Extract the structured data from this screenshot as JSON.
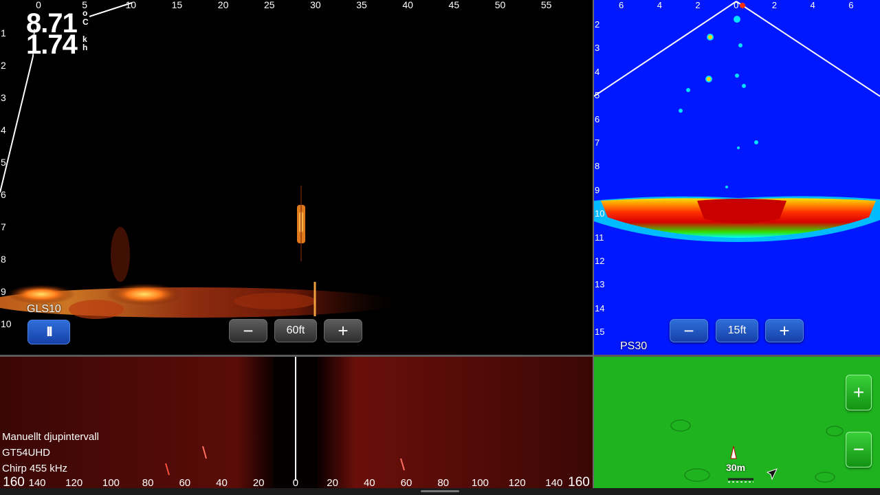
{
  "livescope": {
    "x_ticks": [
      "0",
      "5",
      "10",
      "15",
      "20",
      "25",
      "30",
      "35",
      "40",
      "45",
      "50",
      "55"
    ],
    "y_ticks": [
      "1",
      "2",
      "3",
      "4",
      "5",
      "6",
      "7",
      "8",
      "9",
      "10"
    ],
    "temperature_value": "8.71",
    "temperature_unit_top": "o",
    "temperature_unit_bottom": "C",
    "speed_value": "1.74",
    "speed_unit_top": "k",
    "speed_unit_bottom": "h",
    "source_label": "GLS10",
    "pause_symbol": "II",
    "zoom_out_symbol": "−",
    "range_label": "60ft",
    "zoom_in_symbol": "+"
  },
  "panoptix": {
    "x_ticks": [
      "6",
      "4",
      "2",
      "0",
      "2",
      "4",
      "6"
    ],
    "y_ticks": [
      "2",
      "3",
      "4",
      "5",
      "6",
      "7",
      "8",
      "9",
      "10",
      "11",
      "12",
      "13",
      "14",
      "15"
    ],
    "zoom_out_symbol": "−",
    "range_label": "15ft",
    "zoom_in_symbol": "+",
    "source_label": "PS30"
  },
  "sidevu": {
    "mode_label": "Manuellt djupintervall",
    "transducer_label": "GT54UHD",
    "frequency_label": "Chirp 455 kHz",
    "scale_left_end": "160",
    "scale_ticks": [
      "140",
      "120",
      "100",
      "80",
      "60",
      "40",
      "20",
      "0",
      "20",
      "40",
      "60",
      "80",
      "100",
      "120",
      "140"
    ],
    "scale_right_end": "160"
  },
  "map": {
    "zoom_in_symbol": "+",
    "zoom_out_symbol": "−",
    "scale_label": "30m",
    "colors": {
      "water": "#1fb31f"
    }
  },
  "colors": {
    "panoptix_background": "#0018ff",
    "sidevu_background": "#3a0705",
    "livescope_background": "#000000"
  }
}
